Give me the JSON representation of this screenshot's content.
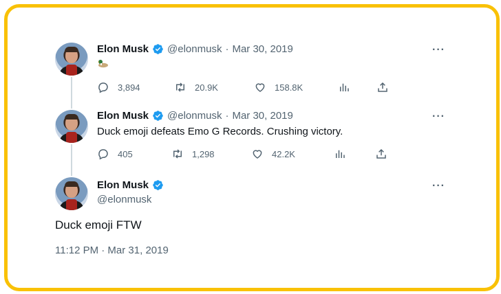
{
  "colors": {
    "frame": "#f9c106",
    "verified": "#1d9bf0",
    "text": "#0f1419",
    "muted": "#536471"
  },
  "tweets": [
    {
      "name": "Elon Musk",
      "handle": "@elonmusk",
      "separator": "·",
      "date": "Mar 30, 2019",
      "text_emoji": "duck-emoji",
      "replies": "3,894",
      "retweets": "20.9K",
      "likes": "158.8K"
    },
    {
      "name": "Elon Musk",
      "handle": "@elonmusk",
      "separator": "·",
      "date": "Mar 30, 2019",
      "text": "Duck emoji defeats Emo G Records. Crushing victory.",
      "replies": "405",
      "retweets": "1,298",
      "likes": "42.2K"
    }
  ],
  "main_tweet": {
    "name": "Elon Musk",
    "handle": "@elonmusk",
    "text": "Duck emoji FTW",
    "timestamp": "11:12 PM · Mar 31, 2019"
  },
  "more_label": "···"
}
